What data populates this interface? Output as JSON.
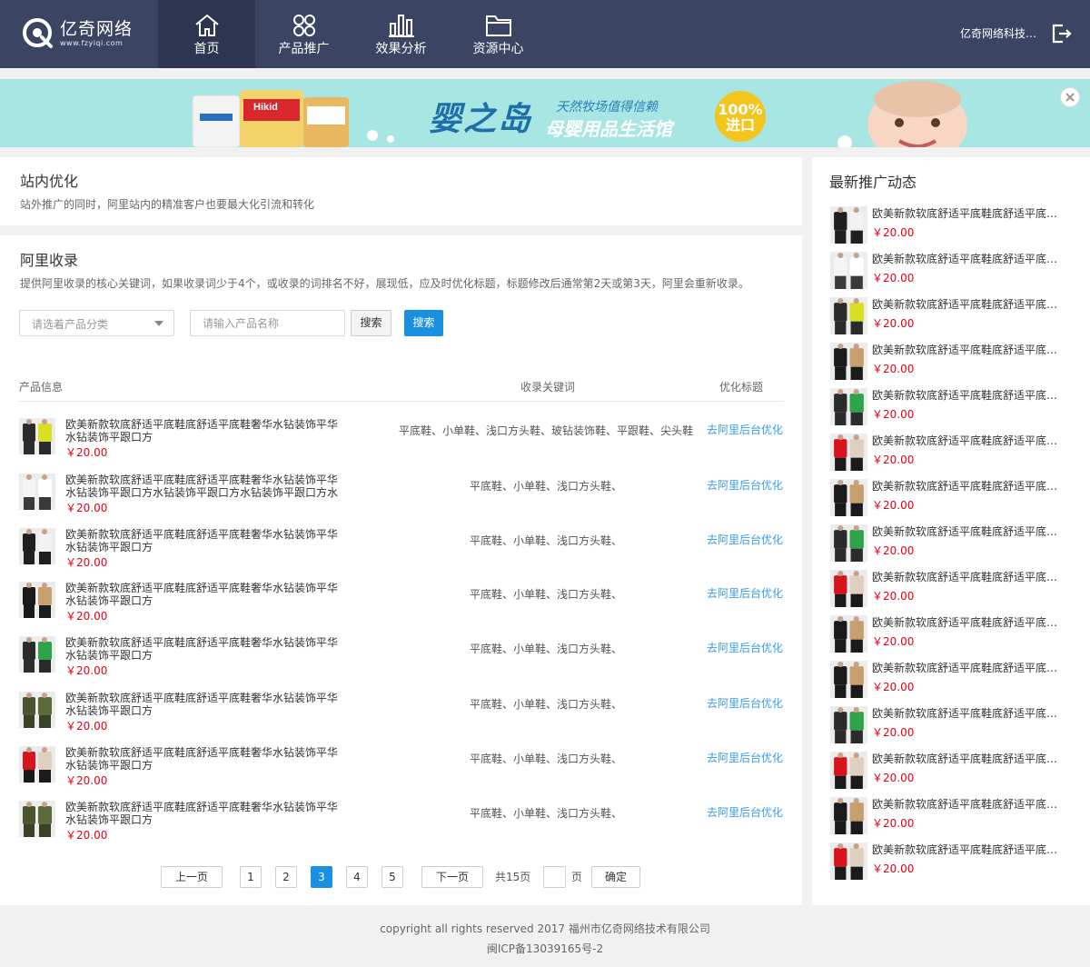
{
  "nav": {
    "logo_name": "亿奇网络",
    "logo_url": "www.fzyiqi.com",
    "items": [
      {
        "label": "首页",
        "icon": "home-icon"
      },
      {
        "label": "产品推广",
        "icon": "apps-icon"
      },
      {
        "label": "效果分析",
        "icon": "bar-chart-icon"
      },
      {
        "label": "资源中心",
        "icon": "folder-icon"
      }
    ],
    "company": "亿奇网络科技有限公司",
    "colors": {
      "bg": "#3b4563",
      "active": "#2d3550",
      "accent": "#1a90e0",
      "price": "#e60012",
      "link": "#3a9be6"
    }
  },
  "banner": {
    "brand": "婴之岛",
    "slogan": "天然牧场值得信赖",
    "sub": "母婴用品生活馆",
    "badge_top": "100%",
    "badge_bottom": "进口",
    "can1": "Hikid"
  },
  "onsite": {
    "title": "站内优化",
    "desc": "站外推广的同时，阿里站内的精准客户也要最大化引流和转化"
  },
  "ali": {
    "title": "阿里收录",
    "desc": "提供阿里收录的核心关键词，如果收录词少于4个，或收录的词排名不好，展现低，应及时优化标题，标题修改后通常第2天或第3天，阿里会重新收录。",
    "category_placeholder": "请选着产品分类",
    "name_placeholder": "请输入产品名称",
    "search_gray": "搜索",
    "search_blue": "搜索",
    "columns": [
      "产品信息",
      "收录关键词",
      "优化标题"
    ],
    "rows": [
      {
        "title": "欧美新款软底舒适平底鞋底舒适平底鞋奢华水钻装饰平华水钻装饰平跟口方",
        "price": "￥20.00",
        "keywords": "平底鞋、小单鞋、浅口方头鞋、玻钻装饰鞋、平跟鞋、尖头鞋",
        "action": "去阿里后台优化",
        "thumb": "yellow"
      },
      {
        "title": "欧美新款软底舒适平底鞋底舒适平底鞋奢华水钻装饰平华水钻装饰平跟口方水钻装饰平跟口方水钻装饰平跟口方水钻装饰平跟口方",
        "price": "￥20.00",
        "keywords": "平底鞋、小单鞋、浅口方头鞋、",
        "action": "去阿里后台优化",
        "thumb": "white"
      },
      {
        "title": "欧美新款软底舒适平底鞋底舒适平底鞋奢华水钻装饰平华水钻装饰平跟口方",
        "price": "￥20.00",
        "keywords": "平底鞋、小单鞋、浅口方头鞋、",
        "action": "去阿里后台优化",
        "thumb": "black-white"
      },
      {
        "title": "欧美新款软底舒适平底鞋底舒适平底鞋奢华水钻装饰平华水钻装饰平跟口方",
        "price": "￥20.00",
        "keywords": "平底鞋、小单鞋、浅口方头鞋、",
        "action": "去阿里后台优化",
        "thumb": "black"
      },
      {
        "title": "欧美新款软底舒适平底鞋底舒适平底鞋奢华水钻装饰平华水钻装饰平跟口方",
        "price": "￥20.00",
        "keywords": "平底鞋、小单鞋、浅口方头鞋、",
        "action": "去阿里后台优化",
        "thumb": "green"
      },
      {
        "title": "欧美新款软底舒适平底鞋底舒适平底鞋奢华水钻装饰平华水钻装饰平跟口方",
        "price": "￥20.00",
        "keywords": "平底鞋、小单鞋、浅口方头鞋、",
        "action": "去阿里后台优化",
        "thumb": "olive"
      },
      {
        "title": "欧美新款软底舒适平底鞋底舒适平底鞋奢华水钻装饰平华水钻装饰平跟口方",
        "price": "￥20.00",
        "keywords": "平底鞋、小单鞋、浅口方头鞋、",
        "action": "去阿里后台优化",
        "thumb": "red"
      },
      {
        "title": "欧美新款软底舒适平底鞋底舒适平底鞋奢华水钻装饰平华水钻装饰平跟口方",
        "price": "￥20.00",
        "keywords": "平底鞋、小单鞋、浅口方头鞋、",
        "action": "去阿里后台优化",
        "thumb": "olive"
      }
    ],
    "pagination": {
      "prev": "上一页",
      "pages": [
        "1",
        "2",
        "3",
        "4",
        "5"
      ],
      "current": "3",
      "next": "下一页",
      "total": "共15页",
      "page_unit": "页",
      "confirm": "确定"
    }
  },
  "sidebar": {
    "title": "最新推广动态",
    "items": [
      {
        "title": "欧美新款软底舒适平底鞋底舒适平底舒适平底鞋",
        "price": "￥20.00",
        "thumb": "black-white"
      },
      {
        "title": "欧美新款软底舒适平底鞋底舒适平底舒适平底鞋",
        "price": "￥20.00",
        "thumb": "white"
      },
      {
        "title": "欧美新款软底舒适平底鞋底舒适平底舒适平底鞋",
        "price": "￥20.00",
        "thumb": "yellow"
      },
      {
        "title": "欧美新款软底舒适平底鞋底舒适平底舒适平底鞋",
        "price": "￥20.00",
        "thumb": "black"
      },
      {
        "title": "欧美新款软底舒适平底鞋底舒适平底舒适平底鞋",
        "price": "￥20.00",
        "thumb": "green"
      },
      {
        "title": "欧美新款软底舒适平底鞋底舒适平底舒适平底鞋",
        "price": "￥20.00",
        "thumb": "red"
      },
      {
        "title": "欧美新款软底舒适平底鞋底舒适平底舒适平底鞋",
        "price": "￥20.00",
        "thumb": "black"
      },
      {
        "title": "欧美新款软底舒适平底鞋底舒适平底舒适平底鞋",
        "price": "￥20.00",
        "thumb": "green"
      },
      {
        "title": "欧美新款软底舒适平底鞋底舒适平底舒适平底鞋",
        "price": "￥20.00",
        "thumb": "red"
      },
      {
        "title": "欧美新款软底舒适平底鞋底舒适平底舒适平底鞋",
        "price": "￥20.00",
        "thumb": "black"
      },
      {
        "title": "欧美新款软底舒适平底鞋底舒适平底舒适平底鞋",
        "price": "￥20.00",
        "thumb": "black"
      },
      {
        "title": "欧美新款软底舒适平底鞋底舒适平底舒适平底鞋",
        "price": "￥20.00",
        "thumb": "green"
      },
      {
        "title": "欧美新款软底舒适平底鞋底舒适平底舒适平底鞋",
        "price": "￥20.00",
        "thumb": "red"
      },
      {
        "title": "欧美新款软底舒适平底鞋底舒适平底舒适平底鞋",
        "price": "￥20.00",
        "thumb": "black"
      },
      {
        "title": "欧美新款软底舒适平底鞋底舒适平底舒适平底鞋",
        "price": "￥20.00",
        "thumb": "red"
      }
    ]
  },
  "footer": {
    "line1": "copyright all rights reserved 2017  福州市亿奇网络技术有限公司",
    "line2": "闽ICP备13039165号-2"
  }
}
